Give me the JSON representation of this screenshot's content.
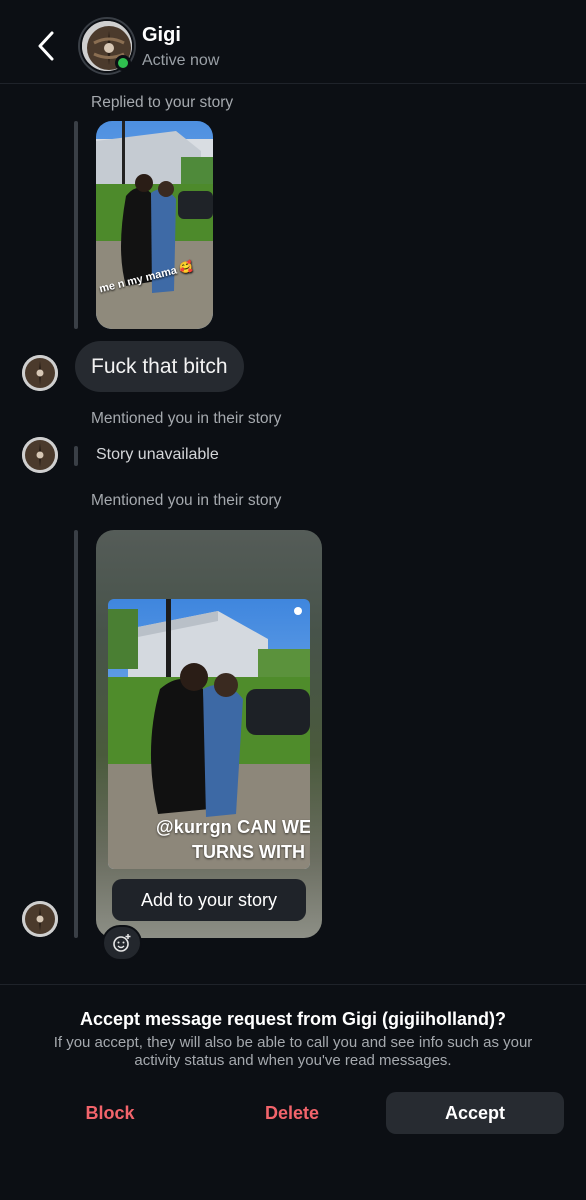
{
  "header": {
    "name": "Gigi",
    "status": "Active now"
  },
  "thread": {
    "replied_label": "Replied to your story",
    "story1_caption": "me n my mama 🥰",
    "message_text": "Fuck that bitch",
    "mention_label_1": "Mentioned you in their story",
    "story_unavailable": "Story unavailable",
    "mention_label_2": "Mentioned you in their story",
    "story2_text_line1": "@kurrgn  CAN WE TAKE",
    "story2_text_line2": "TURNS WITH HER ?",
    "add_to_story": "Add to your story"
  },
  "footer": {
    "title": "Accept message request from Gigi (gigiiholland)?",
    "description": "If you accept, they will also be able to call you and see info such as your activity status and when you've read messages.",
    "block_label": "Block",
    "delete_label": "Delete",
    "accept_label": "Accept"
  },
  "colors": {
    "background": "#0c0f14",
    "bubble": "#262a30",
    "destructive": "#f2646b",
    "online": "#2fbf4f"
  },
  "icons": [
    "back-chevron-icon",
    "add-reaction-icon"
  ]
}
